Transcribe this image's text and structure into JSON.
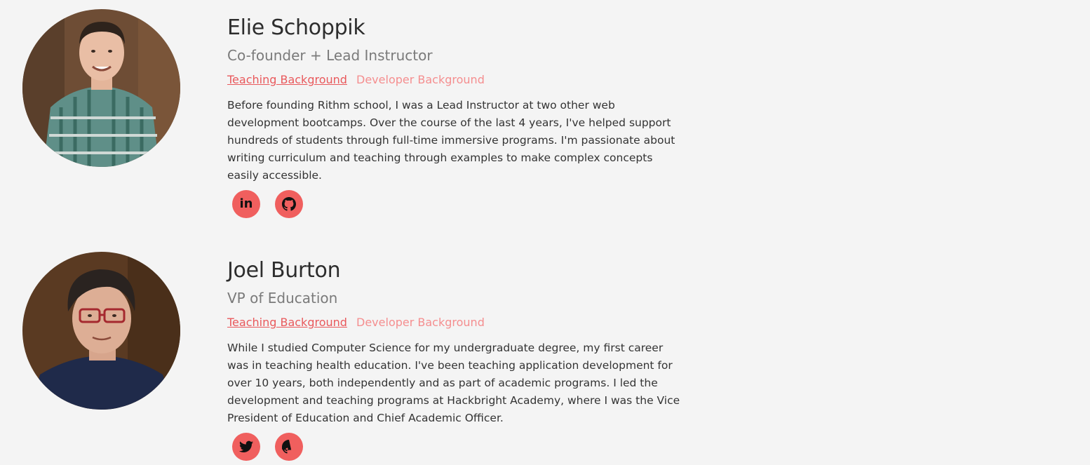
{
  "team": [
    {
      "name": "Elie Schoppik",
      "role": "Co-founder + Lead Instructor",
      "tabs": {
        "teaching": "Teaching Background",
        "developer": "Developer Background"
      },
      "bio": "Before founding Rithm school, I was a Lead Instructor at two other web development bootcamps. Over the course of the last 4 years, I've helped support hundreds of students through full-time immersive programs. I'm passionate about writing curriculum and teaching through examples to make complex concepts easily accessible.",
      "socials": [
        {
          "icon": "linkedin-icon",
          "glyph": "in"
        },
        {
          "icon": "github-icon"
        }
      ]
    },
    {
      "name": "Joel Burton",
      "role": "VP of Education",
      "tabs": {
        "teaching": "Teaching Background",
        "developer": "Developer Background"
      },
      "bio": "While I studied Computer Science for my undergraduate degree, my first career was in teaching health education. I've been teaching application development for over 10 years, both independently and as part of academic programs. I led the development and teaching programs at Hackbright Academy, where I was the Vice President of Education and Chief Academic Officer.",
      "socials": [
        {
          "icon": "twitter-icon"
        },
        {
          "icon": "github-icon"
        }
      ]
    }
  ],
  "colors": {
    "background": "#f4f4f4",
    "accent": "#f05f5e",
    "tab_active": "#e9595c",
    "tab_inactive": "#f58e8f"
  }
}
